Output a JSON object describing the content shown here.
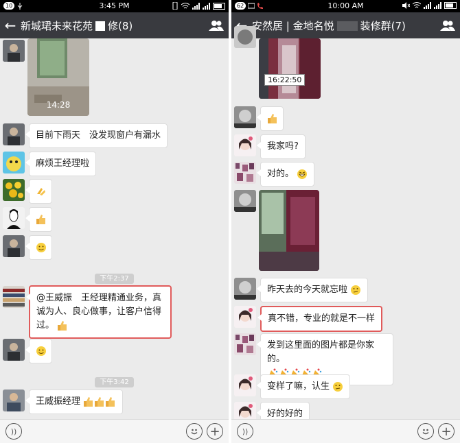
{
  "left": {
    "status": {
      "time": "3:45 PM",
      "badge": "10"
    },
    "title": "新城珺未来花苑",
    "title_suffix": "修(8)",
    "photo_time": "14:28",
    "messages": [
      {
        "text": "目前下雨天　没发现窗户有漏水"
      },
      {
        "text": "麻烦王经理啦"
      },
      {
        "emoji": "clap-icon"
      },
      {
        "emoji": "thumbs-up-icon"
      },
      {
        "emoji": "smile-icon"
      },
      {
        "time": "下午2:37"
      },
      {
        "text": "@王威振　王经理精通业务，真诚为人、良心做事，让客户信得过。",
        "highlight": true
      },
      {
        "emoji": "smile-icon"
      },
      {
        "time": "下午3:42"
      },
      {
        "text": "王威振经理"
      }
    ]
  },
  "right": {
    "status": {
      "time": "10:00 AM",
      "badge": "62"
    },
    "title": "安然居 | 金地名悦",
    "title_suffix": "装修群(7)",
    "photo_time": "16:22:50",
    "messages": [
      {
        "emoji": "thumbs-up-icon"
      },
      {
        "text": "我家吗?"
      },
      {
        "text": "对的。"
      },
      {
        "text": "昨天去的今天就忘啦"
      },
      {
        "text": "真不错，专业的就是不一样",
        "highlight": true
      },
      {
        "text": "发到这里面的图片都是你家的。"
      },
      {
        "text": "变样了嘛，认生"
      },
      {
        "text": "好的好的"
      }
    ]
  },
  "colors": {
    "chat_bg": "#ebebeb",
    "title_bg": "#393a3f",
    "highlight": "#e05a5a"
  }
}
